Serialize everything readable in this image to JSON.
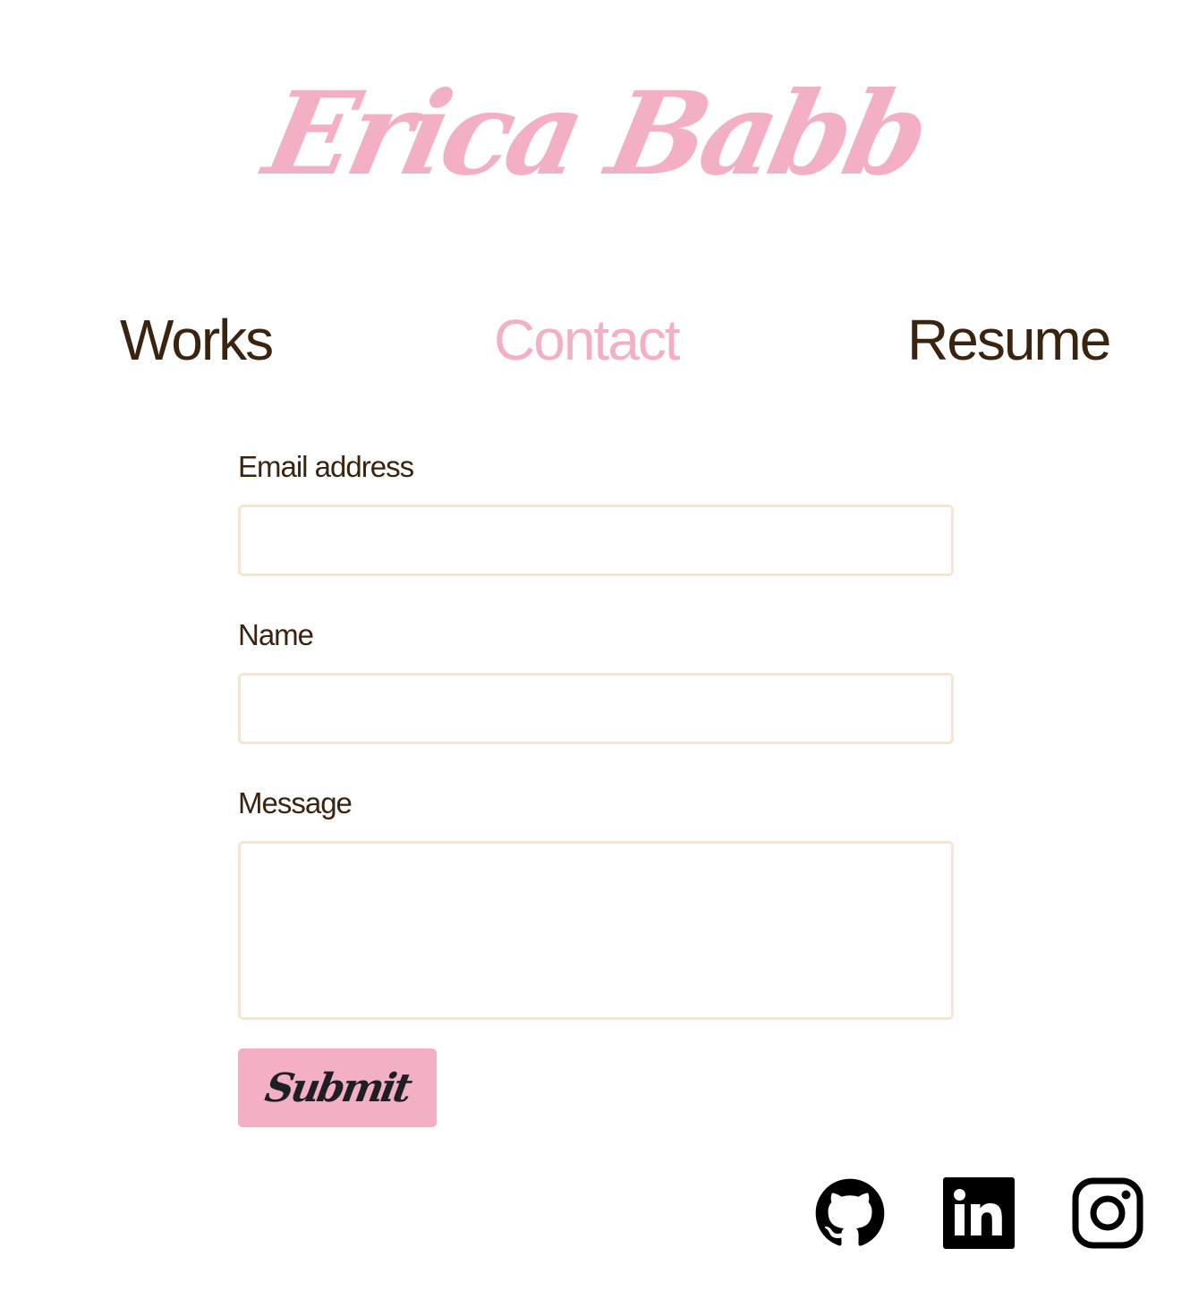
{
  "header": {
    "logo_text": "Erica Babb"
  },
  "nav": {
    "items": [
      {
        "label": "Works"
      },
      {
        "label": "Contact"
      },
      {
        "label": "Resume"
      }
    ]
  },
  "form": {
    "email_label": "Email address",
    "email_value": "",
    "name_label": "Name",
    "name_value": "",
    "message_label": "Message",
    "message_value": "",
    "submit_label": "Submit"
  },
  "social": {
    "icons": [
      "github-icon",
      "linkedin-icon",
      "instagram-icon"
    ]
  },
  "colors": {
    "pink": "#f3afc3",
    "brown": "#3a2410",
    "input_border": "#f3e7d3",
    "icon": "#000000",
    "button_text": "#1e1e24"
  }
}
